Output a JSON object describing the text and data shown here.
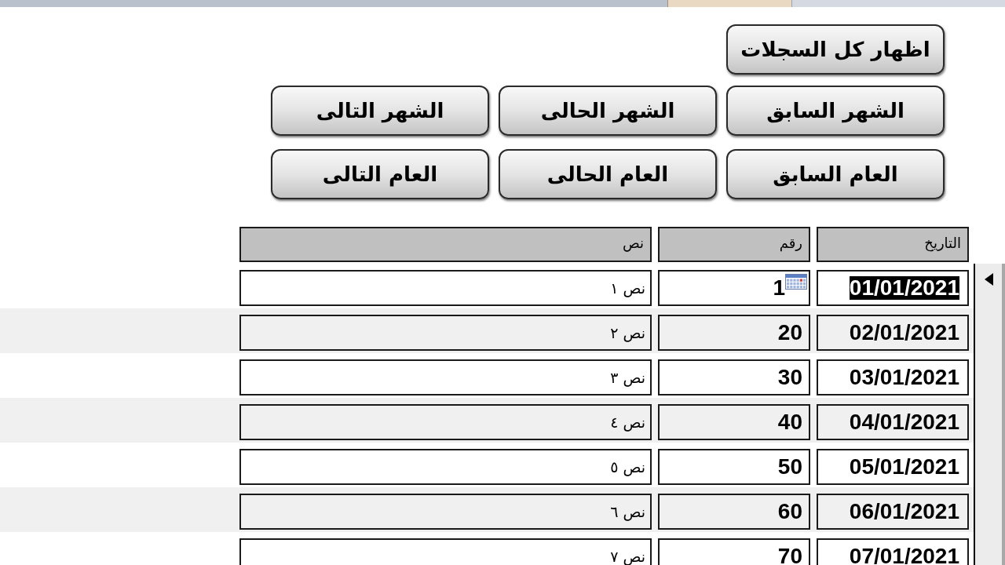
{
  "buttons": [
    [
      "اظهار كل السجلات"
    ],
    [
      "الشهر السابق",
      "الشهر الحالى",
      "الشهر التالى"
    ],
    [
      "العام السابق",
      "العام الحالى",
      "العام التالى"
    ]
  ],
  "table": {
    "columns": [
      "التاريخ",
      "رقم",
      "نص"
    ],
    "rows": [
      {
        "date": "01/01/2021",
        "number": "1",
        "text": "نص ١",
        "current": true
      },
      {
        "date": "02/01/2021",
        "number": "20",
        "text": "نص ٢",
        "current": false
      },
      {
        "date": "03/01/2021",
        "number": "30",
        "text": "نص ٣",
        "current": false
      },
      {
        "date": "04/01/2021",
        "number": "40",
        "text": "نص ٤",
        "current": false
      },
      {
        "date": "05/01/2021",
        "number": "50",
        "text": "نص ٥",
        "current": false
      },
      {
        "date": "06/01/2021",
        "number": "60",
        "text": "نص ٦",
        "current": false
      },
      {
        "date": "07/01/2021",
        "number": "70",
        "text": "نص ٧",
        "current": false
      }
    ]
  }
}
